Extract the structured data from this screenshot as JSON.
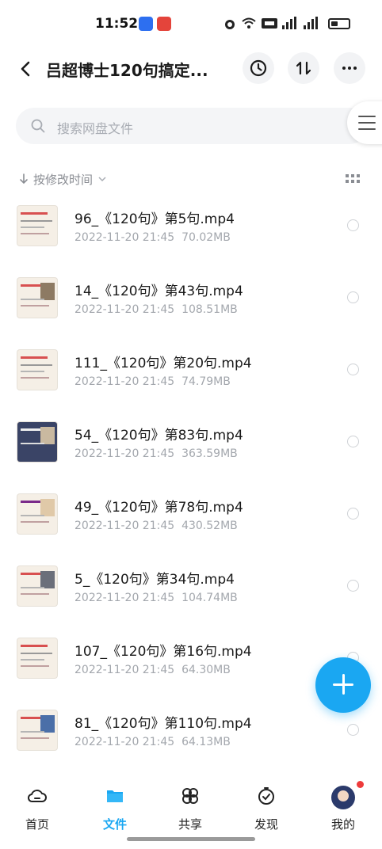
{
  "status_bar": {
    "time": "11:52"
  },
  "header": {
    "title": "吕超博士120句搞定...",
    "history_icon": "history-icon",
    "sort_icon": "transfer-sort-icon",
    "more_icon": "more-dots-icon"
  },
  "search": {
    "placeholder": "搜索网盘文件"
  },
  "sort": {
    "label": "按修改时间"
  },
  "files": [
    {
      "name": "96_《120句》第5句.mp4",
      "date": "2022-11-20  21:45",
      "size": "70.02MB"
    },
    {
      "name": "14_《120句》第43句.mp4",
      "date": "2022-11-20  21:45",
      "size": "108.51MB"
    },
    {
      "name": "111_《120句》第20句.mp4",
      "date": "2022-11-20  21:45",
      "size": "74.79MB"
    },
    {
      "name": "54_《120句》第83句.mp4",
      "date": "2022-11-20  21:45",
      "size": "363.59MB"
    },
    {
      "name": "49_《120句》第78句.mp4",
      "date": "2022-11-20  21:45",
      "size": "430.52MB"
    },
    {
      "name": "5_《120句》第34句.mp4",
      "date": "2022-11-20  21:45",
      "size": "104.74MB"
    },
    {
      "name": "107_《120句》第16句.mp4",
      "date": "2022-11-20  21:45",
      "size": "64.30MB"
    },
    {
      "name": "81_《120句》第110句.mp4",
      "date": "2022-11-20  21:45",
      "size": "64.13MB"
    }
  ],
  "bottom_nav": {
    "home": "首页",
    "files": "文件",
    "share": "共享",
    "discover": "发现",
    "me": "我的"
  },
  "colors": {
    "accent": "#1aa7f2",
    "notification": "#ee3b3b"
  }
}
